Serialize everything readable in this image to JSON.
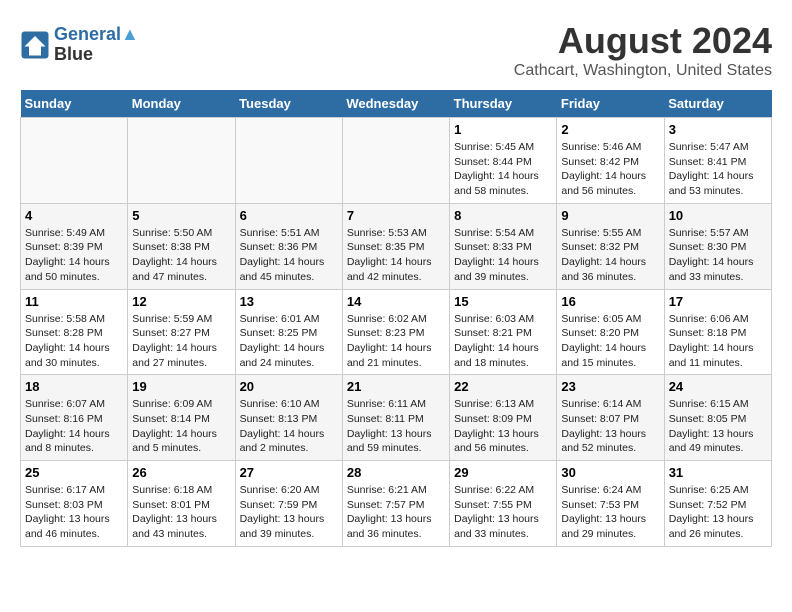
{
  "header": {
    "logo_line1": "General",
    "logo_line2": "Blue",
    "title": "August 2024",
    "subtitle": "Cathcart, Washington, United States"
  },
  "weekdays": [
    "Sunday",
    "Monday",
    "Tuesday",
    "Wednesday",
    "Thursday",
    "Friday",
    "Saturday"
  ],
  "weeks": [
    [
      {
        "day": "",
        "info": ""
      },
      {
        "day": "",
        "info": ""
      },
      {
        "day": "",
        "info": ""
      },
      {
        "day": "",
        "info": ""
      },
      {
        "day": "1",
        "info": "Sunrise: 5:45 AM\nSunset: 8:44 PM\nDaylight: 14 hours\nand 58 minutes."
      },
      {
        "day": "2",
        "info": "Sunrise: 5:46 AM\nSunset: 8:42 PM\nDaylight: 14 hours\nand 56 minutes."
      },
      {
        "day": "3",
        "info": "Sunrise: 5:47 AM\nSunset: 8:41 PM\nDaylight: 14 hours\nand 53 minutes."
      }
    ],
    [
      {
        "day": "4",
        "info": "Sunrise: 5:49 AM\nSunset: 8:39 PM\nDaylight: 14 hours\nand 50 minutes."
      },
      {
        "day": "5",
        "info": "Sunrise: 5:50 AM\nSunset: 8:38 PM\nDaylight: 14 hours\nand 47 minutes."
      },
      {
        "day": "6",
        "info": "Sunrise: 5:51 AM\nSunset: 8:36 PM\nDaylight: 14 hours\nand 45 minutes."
      },
      {
        "day": "7",
        "info": "Sunrise: 5:53 AM\nSunset: 8:35 PM\nDaylight: 14 hours\nand 42 minutes."
      },
      {
        "day": "8",
        "info": "Sunrise: 5:54 AM\nSunset: 8:33 PM\nDaylight: 14 hours\nand 39 minutes."
      },
      {
        "day": "9",
        "info": "Sunrise: 5:55 AM\nSunset: 8:32 PM\nDaylight: 14 hours\nand 36 minutes."
      },
      {
        "day": "10",
        "info": "Sunrise: 5:57 AM\nSunset: 8:30 PM\nDaylight: 14 hours\nand 33 minutes."
      }
    ],
    [
      {
        "day": "11",
        "info": "Sunrise: 5:58 AM\nSunset: 8:28 PM\nDaylight: 14 hours\nand 30 minutes."
      },
      {
        "day": "12",
        "info": "Sunrise: 5:59 AM\nSunset: 8:27 PM\nDaylight: 14 hours\nand 27 minutes."
      },
      {
        "day": "13",
        "info": "Sunrise: 6:01 AM\nSunset: 8:25 PM\nDaylight: 14 hours\nand 24 minutes."
      },
      {
        "day": "14",
        "info": "Sunrise: 6:02 AM\nSunset: 8:23 PM\nDaylight: 14 hours\nand 21 minutes."
      },
      {
        "day": "15",
        "info": "Sunrise: 6:03 AM\nSunset: 8:21 PM\nDaylight: 14 hours\nand 18 minutes."
      },
      {
        "day": "16",
        "info": "Sunrise: 6:05 AM\nSunset: 8:20 PM\nDaylight: 14 hours\nand 15 minutes."
      },
      {
        "day": "17",
        "info": "Sunrise: 6:06 AM\nSunset: 8:18 PM\nDaylight: 14 hours\nand 11 minutes."
      }
    ],
    [
      {
        "day": "18",
        "info": "Sunrise: 6:07 AM\nSunset: 8:16 PM\nDaylight: 14 hours\nand 8 minutes."
      },
      {
        "day": "19",
        "info": "Sunrise: 6:09 AM\nSunset: 8:14 PM\nDaylight: 14 hours\nand 5 minutes."
      },
      {
        "day": "20",
        "info": "Sunrise: 6:10 AM\nSunset: 8:13 PM\nDaylight: 14 hours\nand 2 minutes."
      },
      {
        "day": "21",
        "info": "Sunrise: 6:11 AM\nSunset: 8:11 PM\nDaylight: 13 hours\nand 59 minutes."
      },
      {
        "day": "22",
        "info": "Sunrise: 6:13 AM\nSunset: 8:09 PM\nDaylight: 13 hours\nand 56 minutes."
      },
      {
        "day": "23",
        "info": "Sunrise: 6:14 AM\nSunset: 8:07 PM\nDaylight: 13 hours\nand 52 minutes."
      },
      {
        "day": "24",
        "info": "Sunrise: 6:15 AM\nSunset: 8:05 PM\nDaylight: 13 hours\nand 49 minutes."
      }
    ],
    [
      {
        "day": "25",
        "info": "Sunrise: 6:17 AM\nSunset: 8:03 PM\nDaylight: 13 hours\nand 46 minutes."
      },
      {
        "day": "26",
        "info": "Sunrise: 6:18 AM\nSunset: 8:01 PM\nDaylight: 13 hours\nand 43 minutes."
      },
      {
        "day": "27",
        "info": "Sunrise: 6:20 AM\nSunset: 7:59 PM\nDaylight: 13 hours\nand 39 minutes."
      },
      {
        "day": "28",
        "info": "Sunrise: 6:21 AM\nSunset: 7:57 PM\nDaylight: 13 hours\nand 36 minutes."
      },
      {
        "day": "29",
        "info": "Sunrise: 6:22 AM\nSunset: 7:55 PM\nDaylight: 13 hours\nand 33 minutes."
      },
      {
        "day": "30",
        "info": "Sunrise: 6:24 AM\nSunset: 7:53 PM\nDaylight: 13 hours\nand 29 minutes."
      },
      {
        "day": "31",
        "info": "Sunrise: 6:25 AM\nSunset: 7:52 PM\nDaylight: 13 hours\nand 26 minutes."
      }
    ]
  ]
}
